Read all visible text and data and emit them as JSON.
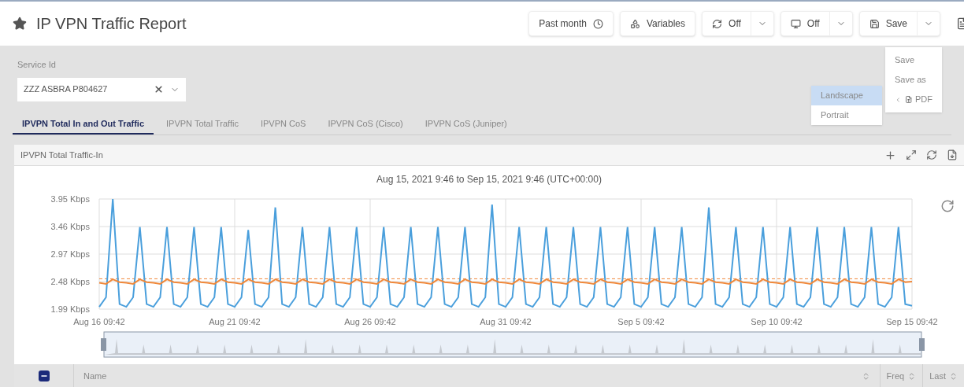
{
  "header": {
    "title": "IP VPN Traffic Report",
    "buttons": [
      {
        "kind": "time",
        "label": "Past month",
        "split": false
      },
      {
        "kind": "variables",
        "label": "Variables",
        "split": false
      },
      {
        "kind": "refresh",
        "label": "Off",
        "split": true
      },
      {
        "kind": "display",
        "label": "Off",
        "split": true
      },
      {
        "kind": "save",
        "label": "Save",
        "split": true
      }
    ]
  },
  "save_menu": {
    "items": [
      {
        "kind": "item",
        "label": "Save"
      },
      {
        "kind": "item",
        "label": "Save as"
      },
      {
        "kind": "submenu",
        "label": "PDF"
      }
    ],
    "submenu": [
      {
        "label": "Landscape",
        "selected": true
      },
      {
        "label": "Portrait",
        "selected": false
      }
    ]
  },
  "filter": {
    "label": "Service Id",
    "value": "ZZZ ASBRA P804627"
  },
  "tabs": [
    {
      "label": "IPVPN Total In and Out Traffic",
      "selected": true
    },
    {
      "label": "IPVPN Total Traffic",
      "selected": false
    },
    {
      "label": "IPVPN CoS",
      "selected": false
    },
    {
      "label": "IPVPN CoS (Cisco)",
      "selected": false
    },
    {
      "label": "IPVPN CoS (Juniper)",
      "selected": false
    }
  ],
  "panel": {
    "title": "IPVPN Total Traffic-In",
    "chart_data": {
      "type": "line",
      "title": "Aug 15, 2021 9:46 to Sep 15, 2021 9:46 (UTC+00:00)",
      "series": [
        {
          "color": "#4a9fdc",
          "values": [
            2.03,
            2.2,
            3.95,
            2.08,
            2.03,
            2.2,
            3.45,
            2.08,
            2.03,
            2.2,
            3.45,
            2.08,
            2.03,
            2.2,
            3.45,
            2.08,
            2.03,
            2.2,
            3.45,
            2.08,
            2.03,
            2.2,
            3.4,
            2.08,
            2.03,
            2.2,
            3.8,
            2.08,
            2.03,
            2.2,
            3.45,
            2.08,
            2.03,
            2.2,
            3.45,
            2.08,
            2.03,
            2.2,
            3.45,
            2.08,
            2.03,
            2.2,
            3.45,
            2.08,
            2.03,
            2.2,
            3.45,
            2.08,
            2.03,
            2.2,
            3.45,
            2.08,
            2.03,
            2.2,
            3.45,
            2.08,
            2.03,
            2.2,
            3.85,
            2.08,
            2.03,
            2.2,
            3.45,
            2.08,
            2.03,
            2.2,
            3.45,
            2.08,
            2.03,
            2.2,
            3.45,
            2.08,
            2.03,
            2.2,
            3.45,
            2.08,
            2.03,
            2.2,
            3.45,
            2.08,
            2.03,
            2.2,
            3.45,
            2.08,
            2.03,
            2.2,
            3.45,
            2.08,
            2.03,
            2.2,
            3.8,
            2.08,
            2.03,
            2.2,
            3.45,
            2.08,
            2.03,
            2.2,
            3.45,
            2.08,
            2.03,
            2.2,
            3.45,
            2.08,
            2.03,
            2.2,
            3.45,
            2.08,
            2.03,
            2.2,
            3.45,
            2.08,
            2.03,
            2.2,
            3.45,
            2.08,
            2.03,
            2.2,
            3.45,
            2.08,
            2.05
          ]
        },
        {
          "color": "#f0883a",
          "values": [
            2.46,
            2.44,
            2.52,
            2.47,
            2.46,
            2.44,
            2.52,
            2.47,
            2.46,
            2.44,
            2.52,
            2.47,
            2.46,
            2.44,
            2.52,
            2.47,
            2.46,
            2.44,
            2.52,
            2.47,
            2.46,
            2.44,
            2.52,
            2.47,
            2.46,
            2.44,
            2.52,
            2.47,
            2.46,
            2.44,
            2.52,
            2.47,
            2.46,
            2.44,
            2.52,
            2.47,
            2.46,
            2.44,
            2.52,
            2.47,
            2.46,
            2.44,
            2.52,
            2.47,
            2.46,
            2.44,
            2.52,
            2.47,
            2.46,
            2.44,
            2.52,
            2.47,
            2.46,
            2.44,
            2.52,
            2.47,
            2.46,
            2.44,
            2.52,
            2.47,
            2.46,
            2.44,
            2.52,
            2.47,
            2.46,
            2.44,
            2.52,
            2.47,
            2.46,
            2.44,
            2.52,
            2.47,
            2.46,
            2.44,
            2.52,
            2.47,
            2.46,
            2.44,
            2.52,
            2.47,
            2.46,
            2.44,
            2.52,
            2.47,
            2.46,
            2.44,
            2.52,
            2.47,
            2.46,
            2.44,
            2.52,
            2.47,
            2.46,
            2.44,
            2.52,
            2.47,
            2.46,
            2.44,
            2.52,
            2.47,
            2.46,
            2.44,
            2.52,
            2.47,
            2.46,
            2.44,
            2.52,
            2.47,
            2.46,
            2.44,
            2.52,
            2.47,
            2.46,
            2.44,
            2.52,
            2.47,
            2.46,
            2.44,
            2.52,
            2.47,
            2.48
          ]
        }
      ],
      "ylim": [
        1.99,
        3.95
      ],
      "categories": [
        "Aug 16 09:42",
        null,
        null,
        null,
        null,
        null,
        null,
        null,
        null,
        null,
        null,
        null,
        null,
        null,
        null,
        null,
        null,
        null,
        null,
        null,
        "Aug 21 09:42",
        null,
        null,
        null,
        null,
        null,
        null,
        null,
        null,
        null,
        null,
        null,
        null,
        null,
        null,
        null,
        null,
        null,
        null,
        null,
        "Aug 26 09:42",
        null,
        null,
        null,
        null,
        null,
        null,
        null,
        null,
        null,
        null,
        null,
        null,
        null,
        null,
        null,
        null,
        null,
        null,
        null,
        "Aug 31 09:42",
        null,
        null,
        null,
        null,
        null,
        null,
        null,
        null,
        null,
        null,
        null,
        null,
        null,
        null,
        null,
        null,
        null,
        null,
        null,
        "Sep 5 09:42",
        null,
        null,
        null,
        null,
        null,
        null,
        null,
        null,
        null,
        null,
        null,
        null,
        null,
        null,
        null,
        null,
        null,
        null,
        null,
        "Sep 10 09:42",
        null,
        null,
        null,
        null,
        null,
        null,
        null,
        null,
        null,
        null,
        null,
        null,
        null,
        null,
        null,
        null,
        null,
        null,
        null,
        "Sep 15 09:42"
      ],
      "yticks": [
        {
          "value": 1.99,
          "label": "1.99 Kbps"
        },
        {
          "value": 2.48,
          "label": "2.48 Kbps"
        },
        {
          "value": 2.97,
          "label": "2.97 Kbps"
        },
        {
          "value": 3.46,
          "label": "3.46 Kbps"
        },
        {
          "value": 3.95,
          "label": "3.95 Kbps"
        }
      ],
      "grid": true,
      "ref_lines": [
        {
          "axis": "y",
          "value": 2.53,
          "color": "#f0883a"
        }
      ]
    }
  },
  "table": {
    "select_all": {
      "indeterminate": true
    },
    "columns": [
      {
        "label": "Name"
      },
      {
        "label": "Freq"
      },
      {
        "label": "Last"
      }
    ]
  }
}
